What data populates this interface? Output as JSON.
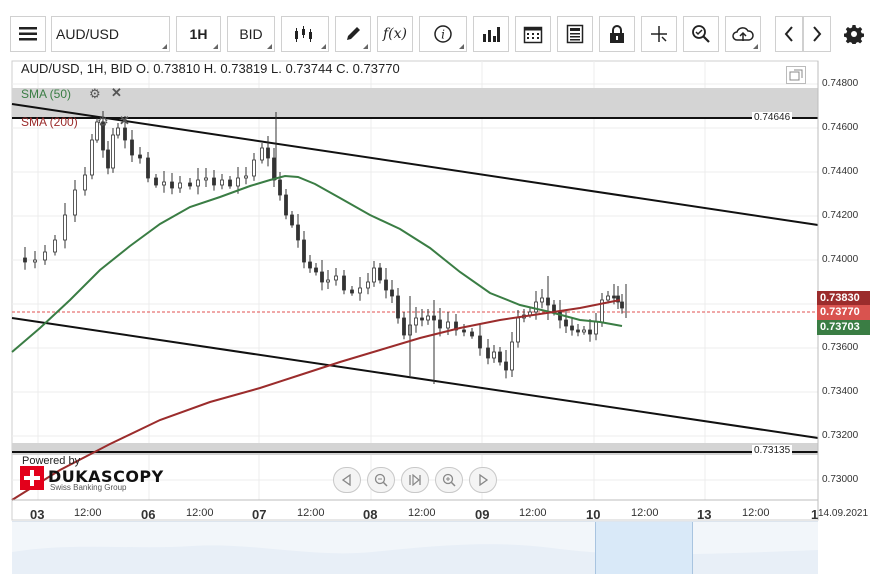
{
  "toolbar": {
    "symbol": "AUD/USD",
    "timeframe": "1H",
    "price_side": "BID"
  },
  "chart": {
    "info": "AUD/USD, 1H, BID    O. 0.73810 H. 0.73819 L. 0.73744 C. 0.73770",
    "sma50_label": "SMA (50)",
    "sma200_label": "SMA (200)",
    "level_upper": "0.74646",
    "level_lower": "0.73135",
    "tag_sma200": "0.73830",
    "tag_current": "0.73770",
    "tag_sma50": "0.73703",
    "y_axis": [
      "0.74800",
      "0.74600",
      "0.74400",
      "0.74200",
      "0.74000",
      "0.73800",
      "0.73600",
      "0.73400",
      "0.73200",
      "0.73000"
    ],
    "x_labels": [
      {
        "text": "03",
        "day": true
      },
      {
        "text": "12:00",
        "day": false
      },
      {
        "text": "06",
        "day": true
      },
      {
        "text": "12:00",
        "day": false
      },
      {
        "text": "07",
        "day": true
      },
      {
        "text": "12:00",
        "day": false
      },
      {
        "text": "08",
        "day": true
      },
      {
        "text": "12:00",
        "day": false
      },
      {
        "text": "09",
        "day": true
      },
      {
        "text": "12:00",
        "day": false
      },
      {
        "text": "10",
        "day": true
      },
      {
        "text": "12:00",
        "day": false
      },
      {
        "text": "13",
        "day": true
      },
      {
        "text": "12:00",
        "day": false
      },
      {
        "text": "1",
        "day": true
      }
    ],
    "date_corner": "14.09.2021",
    "powered_by": "Powered by",
    "logo_name": "DUKASCOPY",
    "logo_sub": "Swiss Banking Group"
  },
  "colors": {
    "sma50": "#3a7d44",
    "sma200": "#9b2c2c",
    "candle": "#333333",
    "current_price": "#e05050",
    "tag_sma50": "#3a7d44",
    "tag_sma200": "#9b2c2c",
    "tag_current": "#d9534f"
  },
  "icons": [
    "menu-icon",
    "candle-type-icon",
    "pencil-icon",
    "function-icon",
    "info-icon",
    "bar-chart-icon",
    "calendar-icon",
    "news-icon",
    "lock-icon",
    "crosshair-icon",
    "zoom-icon",
    "cloud-upload-icon",
    "chevron-left-icon",
    "chevron-right-icon",
    "gear-icon"
  ]
}
